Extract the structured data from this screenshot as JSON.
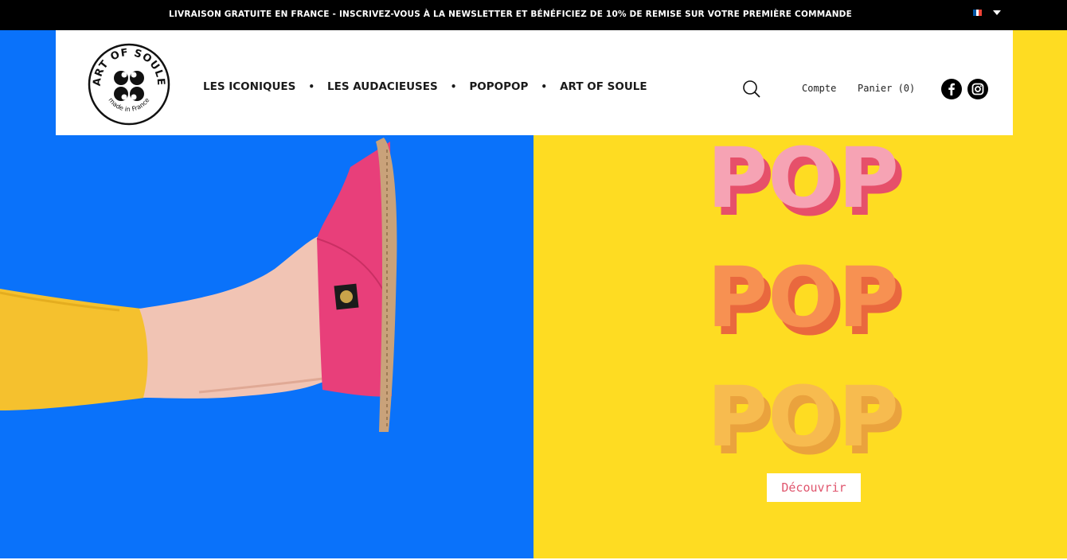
{
  "announcement": "LIVRAISON GRATUITE EN FRANCE - INSCRIVEZ-VOUS À LA NEWSLETTER ET BÉNÉFICIEZ DE 10% DE REMISE SUR VOTRE PREMIÈRE COMMANDE",
  "language": {
    "flag_colors": [
      "#0055a4",
      "#ffffff",
      "#ef4135"
    ]
  },
  "logo": {
    "top_text": "ART OF SOULE",
    "bottom_text": "made in France"
  },
  "nav": {
    "items": [
      {
        "label": "LES ICONIQUES"
      },
      {
        "label": "LES AUDACIEUSES"
      },
      {
        "label": "POPOPOP"
      },
      {
        "label": "ART OF SOULE"
      }
    ],
    "separator": "•"
  },
  "header_links": {
    "account": "Compte",
    "cart": "Panier (0)"
  },
  "social": {
    "icons": [
      "facebook-icon",
      "instagram-icon"
    ]
  },
  "hero": {
    "pop_words": [
      "POP",
      "POP",
      "POP"
    ],
    "cta_label": "Découvrir",
    "colors": {
      "left_bg": "#0a72fa",
      "right_bg": "#fedc22",
      "shoe": "#e83f7a",
      "pants": "#f5c12e",
      "pop_pink": "#f6a3b4",
      "pop_orange": "#f79152",
      "pop_gold": "#f7bb4f"
    }
  }
}
